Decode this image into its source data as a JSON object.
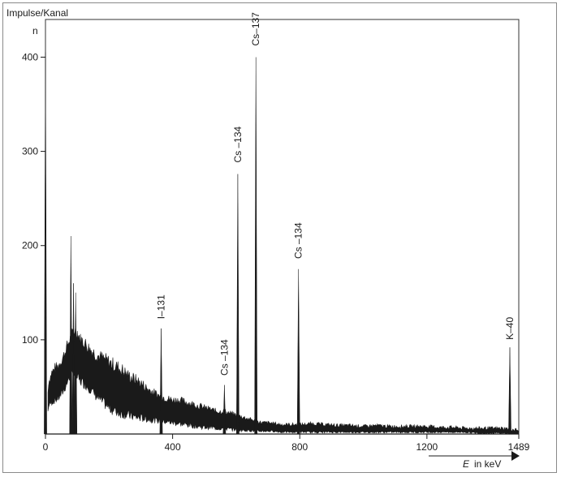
{
  "chart_data": {
    "type": "line",
    "title": "",
    "ylabel": "Impulse/Kanal",
    "ylabel_symbol": "n",
    "xlabel_symbol": "E",
    "xlabel_unit": "in keV",
    "xlim": [
      0,
      1489
    ],
    "ylim": [
      0,
      440
    ],
    "x_ticks": [
      0,
      400,
      800,
      1200,
      1489
    ],
    "y_ticks": [
      100,
      200,
      300,
      400
    ],
    "grid": false,
    "legend": "none",
    "line_color": "#1a1a1a",
    "spectrum": {
      "x": [
        0,
        10,
        20,
        30,
        40,
        50,
        60,
        70,
        80,
        90,
        100,
        110,
        120,
        140,
        160,
        180,
        200,
        220,
        240,
        260,
        280,
        300,
        320,
        340,
        360,
        380,
        400,
        420,
        440,
        460,
        480,
        500,
        520,
        540,
        560,
        580,
        600,
        620,
        640,
        660,
        680,
        700,
        720,
        740,
        760,
        780,
        800,
        840,
        880,
        920,
        960,
        1000,
        1040,
        1080,
        1120,
        1160,
        1200,
        1240,
        1280,
        1320,
        1360,
        1400,
        1440,
        1489
      ],
      "upper": [
        0,
        55,
        65,
        70,
        72,
        78,
        85,
        95,
        102,
        110,
        108,
        100,
        98,
        90,
        84,
        80,
        76,
        72,
        68,
        62,
        58,
        54,
        48,
        44,
        40,
        38,
        36,
        36,
        34,
        32,
        30,
        28,
        26,
        24,
        24,
        22,
        20,
        18,
        16,
        14,
        12,
        12,
        11,
        10,
        10,
        10,
        10,
        11,
        10,
        9,
        9,
        8,
        9,
        8,
        8,
        8,
        8,
        7,
        7,
        6,
        6,
        6,
        6,
        4
      ],
      "lower": [
        0,
        30,
        34,
        36,
        38,
        42,
        48,
        56,
        62,
        64,
        60,
        56,
        54,
        48,
        40,
        34,
        28,
        24,
        22,
        20,
        18,
        17,
        16,
        15,
        14,
        13,
        12,
        11,
        10,
        9,
        8,
        7,
        7,
        6,
        6,
        5,
        5,
        4,
        4,
        3,
        3,
        3,
        3,
        2,
        2,
        2,
        2,
        2,
        2,
        2,
        2,
        2,
        2,
        2,
        2,
        2,
        2,
        2,
        2,
        2,
        1,
        1,
        1,
        0
      ]
    },
    "spikes": [
      {
        "x": 0,
        "y": 405
      },
      {
        "x": 80,
        "y": 210
      },
      {
        "x": 88,
        "y": 160
      },
      {
        "x": 95,
        "y": 150
      },
      {
        "x": 364,
        "y": 112
      },
      {
        "x": 563,
        "y": 52
      },
      {
        "x": 605,
        "y": 276
      },
      {
        "x": 662,
        "y": 400
      },
      {
        "x": 796,
        "y": 175
      },
      {
        "x": 1461,
        "y": 92
      }
    ],
    "annotations": [
      {
        "text": "I–131",
        "x": 364,
        "y": 122
      },
      {
        "text": "Cs –134",
        "x": 563,
        "y": 62
      },
      {
        "text": "Cs –134",
        "x": 605,
        "y": 288
      },
      {
        "text": "Cs–137",
        "x": 662,
        "y": 412
      },
      {
        "text": "Cs –134",
        "x": 796,
        "y": 186
      },
      {
        "text": "K–40",
        "x": 1461,
        "y": 100
      }
    ]
  }
}
